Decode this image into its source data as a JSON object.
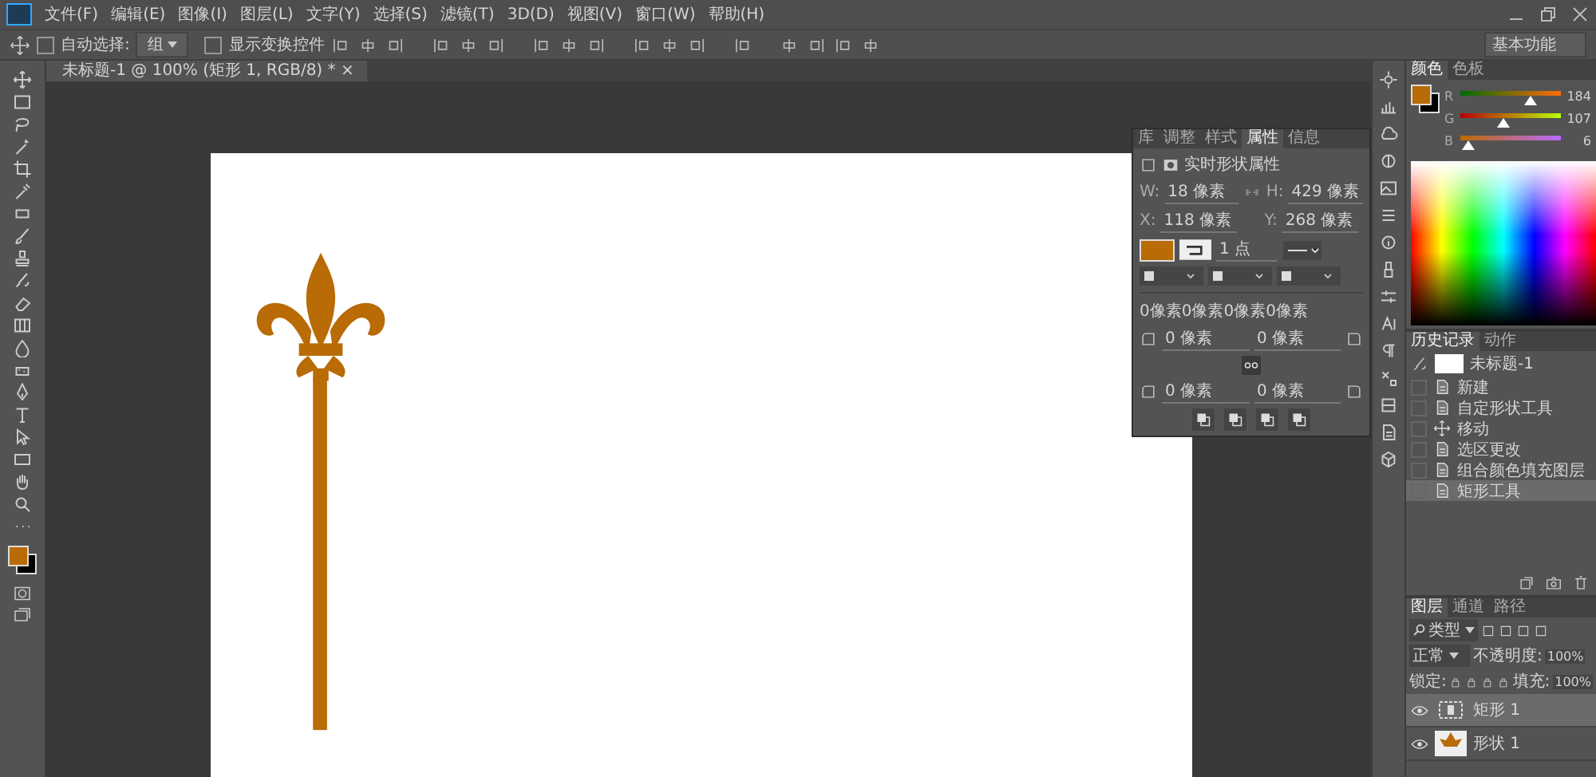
{
  "menu_bar": {
    "items": [
      "文件(F)",
      "编辑(E)",
      "图像(I)",
      "图层(L)",
      "文字(Y)",
      "选择(S)",
      "滤镜(T)",
      "3D(D)",
      "视图(V)",
      "窗口(W)",
      "帮助(H)"
    ]
  },
  "options_bar": {
    "auto_select": {
      "label": "自动选择:",
      "checked": false
    },
    "select_target": "组",
    "show_transform": {
      "label": "显示变换控件",
      "checked": false
    },
    "workspace": "基本功能"
  },
  "document_tab": {
    "title": "未标题-1 @ 100% (矩形 1, RGB/8) *",
    "close": "×"
  },
  "properties_panel": {
    "tabs": [
      {
        "label": "库",
        "selected": false
      },
      {
        "label": "调整",
        "selected": false
      },
      {
        "label": "样式",
        "selected": false
      },
      {
        "label": "属性",
        "selected": true
      },
      {
        "label": "信息",
        "selected": false
      }
    ],
    "title": "实时形状属性",
    "size": [
      {
        "label": "W:",
        "value": "18 像素"
      },
      {
        "label": "H:",
        "value": "429 像素"
      }
    ],
    "position": [
      {
        "label": "X:",
        "value": "118 像素"
      },
      {
        "label": "Y:",
        "value": "268 像素"
      }
    ],
    "stroke_width": "1 点",
    "corner_summary": "0像素0像素0像素0像素",
    "corners": [
      "0 像素",
      "0 像素",
      "0 像素",
      "0 像素"
    ]
  },
  "color_panel": {
    "tabs": [
      {
        "label": "颜色",
        "selected": true
      },
      {
        "label": "色板",
        "selected": false
      }
    ],
    "sliders": [
      {
        "label": "R",
        "level": 0.72,
        "reading": "184"
      },
      {
        "label": "G",
        "level": 0.42,
        "reading": "107"
      },
      {
        "label": "B",
        "level": 0.02,
        "reading": "6"
      }
    ]
  },
  "history_panel": {
    "tabs": [
      {
        "label": "历史记录",
        "selected": true
      },
      {
        "label": "动作",
        "selected": false
      }
    ],
    "snapshot": "未标题-1",
    "items": [
      {
        "label": "新建",
        "kind": "document",
        "selected": false
      },
      {
        "label": "自定形状工具",
        "kind": "document",
        "selected": false
      },
      {
        "label": "移动",
        "kind": "move",
        "selected": false
      },
      {
        "label": "选区更改",
        "kind": "document",
        "selected": false
      },
      {
        "label": "组合颜色填充图层",
        "kind": "document",
        "selected": false
      },
      {
        "label": "矩形工具",
        "kind": "document",
        "selected": true
      }
    ]
  },
  "layers_panel": {
    "tabs": [
      {
        "label": "图层",
        "selected": true
      },
      {
        "label": "通道",
        "selected": false
      },
      {
        "label": "路径",
        "selected": false
      }
    ],
    "filter": "类型",
    "blend_mode": "正常",
    "opacity_label": "不透明度:",
    "opacity": "100%",
    "lock_label": "锁定:",
    "fill_label": "填充:",
    "fill": "100%",
    "layers": [
      {
        "name": "矩形 1",
        "kind": "rectangle",
        "visible": true,
        "selected": true
      },
      {
        "name": "形状 1",
        "kind": "custom-shape",
        "visible": true,
        "selected": false
      }
    ]
  }
}
